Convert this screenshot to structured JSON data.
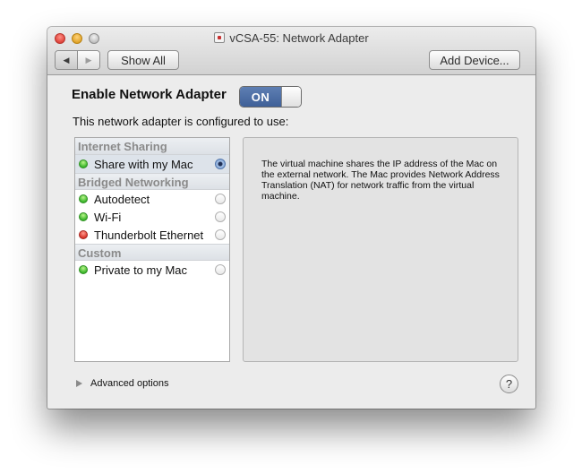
{
  "window": {
    "title": "vCSA-55: Network Adapter"
  },
  "toolbar": {
    "back_glyph": "◀",
    "forward_glyph": "▶",
    "show_all_label": "Show All",
    "add_device_label": "Add Device..."
  },
  "main": {
    "enable_label": "Enable Network Adapter",
    "toggle_state": "ON",
    "config_label": "This network adapter is configured to use:",
    "groups": [
      {
        "header": "Internet Sharing",
        "items": [
          {
            "label": "Share with my Mac",
            "status": "green",
            "selected": true
          }
        ]
      },
      {
        "header": "Bridged Networking",
        "items": [
          {
            "label": "Autodetect",
            "status": "green",
            "selected": false
          },
          {
            "label": "Wi-Fi",
            "status": "green",
            "selected": false
          },
          {
            "label": "Thunderbolt Ethernet",
            "status": "red",
            "selected": false
          }
        ]
      },
      {
        "header": "Custom",
        "items": [
          {
            "label": "Private to my Mac",
            "status": "green",
            "selected": false
          }
        ]
      }
    ],
    "description": "The virtual machine shares the IP address of the Mac on the external network. The Mac provides Network Address Translation (NAT) for network traffic from the virtual machine.",
    "advanced_label": "Advanced options",
    "help_glyph": "?"
  },
  "colors": {
    "status_green": "#3ab52b",
    "status_red": "#d8342a",
    "toggle_on": "#4a6ca5"
  },
  "icons": {
    "close": "close-button-icon",
    "minimize": "minimize-button-icon",
    "zoom": "zoom-button-icon",
    "title": "vmware-vm-icon",
    "status": "status-dot-icon",
    "disclosure": "disclosure-triangle-icon"
  }
}
